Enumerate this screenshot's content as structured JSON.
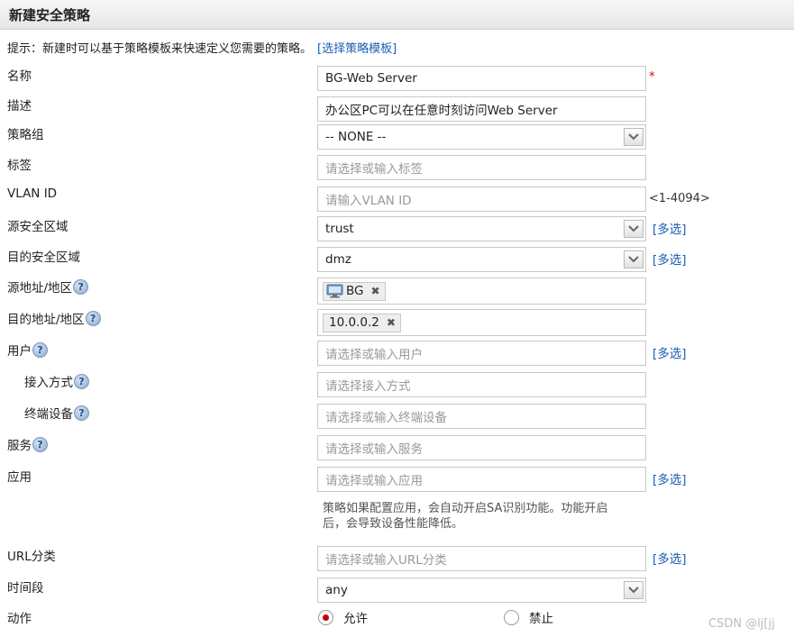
{
  "title": "新建安全策略",
  "hint": {
    "text": "提示：新建时可以基于策略模板来快速定义您需要的策略。",
    "link": "[选择策略模板]"
  },
  "fields": {
    "name": {
      "label": "名称",
      "value": "BG-Web  Server",
      "required_mark": "*"
    },
    "description": {
      "label": "描述",
      "value": "办公区PC可以在任意时刻访问Web  Server"
    },
    "policy_group": {
      "label": "策略组",
      "value": "-- NONE --"
    },
    "tag": {
      "label": "标签",
      "placeholder": "请选择或输入标签"
    },
    "vlan": {
      "label": "VLAN ID",
      "placeholder": "请输入VLAN ID",
      "range": "<1-4094>"
    },
    "src_zone": {
      "label": "源安全区域",
      "value": "trust",
      "multi": "[多选]"
    },
    "dst_zone": {
      "label": "目的安全区域",
      "value": "dmz",
      "multi": "[多选]"
    },
    "src_addr": {
      "label": "源地址/地区",
      "tag": "BG",
      "tag_icon": "computer-icon"
    },
    "dst_addr": {
      "label": "目的地址/地区",
      "tag": "10.0.0.2"
    },
    "user": {
      "label": "用户",
      "placeholder": "请选择或输入用户",
      "multi": "[多选]"
    },
    "access_mode": {
      "label": "接入方式",
      "placeholder": "请选择接入方式"
    },
    "terminal": {
      "label": "终端设备",
      "placeholder": "请选择或输入终端设备"
    },
    "service": {
      "label": "服务",
      "placeholder": "请选择或输入服务"
    },
    "application": {
      "label": "应用",
      "placeholder": "请选择或输入应用",
      "multi": "[多选]",
      "note_line1": "策略如果配置应用，会自动开启SA识别功能。功能开启",
      "note_line2": "后，会导致设备性能降低。"
    },
    "url": {
      "label": "URL分类",
      "placeholder": "请选择或输入URL分类",
      "multi": "[多选]"
    },
    "schedule": {
      "label": "时间段",
      "value": "any"
    },
    "action": {
      "label": "动作",
      "options": [
        "允许",
        "禁止"
      ],
      "selected": "允许"
    }
  },
  "help_glyph": "?",
  "remove_glyph": "✖",
  "watermark": "CSDN @lj[jj",
  "colors": {
    "link": "#1a5fb4",
    "required": "#d40000",
    "radio_selected": "#c00000"
  }
}
